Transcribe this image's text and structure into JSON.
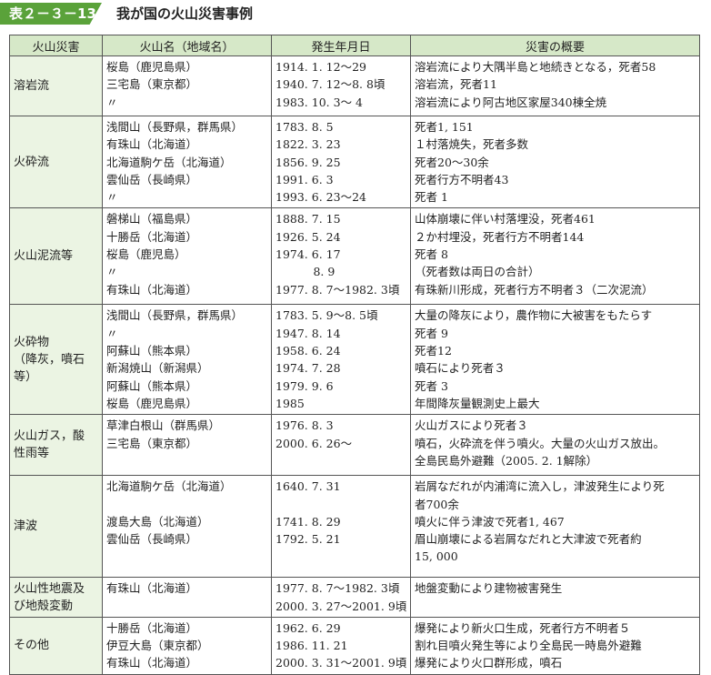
{
  "title": {
    "tab": "表２－３－13",
    "text": "我が国の火山災害事例"
  },
  "headers": [
    "火山災害",
    "火山名（地域名）",
    "発生年月日",
    "災害の概要"
  ],
  "rows": [
    {
      "category": "溶岩流",
      "names": [
        "桜島（鹿児島県）",
        "三宅島（東京都）",
        "〃"
      ],
      "dates": [
        "1914. 1. 12～29",
        "1940. 7. 12～8. 8頃",
        "1983. 10. 3～ 4"
      ],
      "summary": [
        "溶岩流により大隅半島と地続きとなる，死者58",
        "溶岩流，死者11",
        "溶岩流により阿古地区家屋340棟全焼"
      ]
    },
    {
      "category": "火砕流",
      "names": [
        "浅間山（長野県，群馬県）",
        "有珠山（北海道）",
        "北海道駒ケ岳（北海道）",
        "雲仙岳（長崎県）",
        "〃"
      ],
      "dates": [
        "1783. 8. 5",
        "1822. 3. 23",
        "1856. 9. 25",
        "1991. 6. 3",
        "1993. 6. 23～24"
      ],
      "summary": [
        "死者1, 151",
        "１村落焼失，死者多数",
        "死者20～30余",
        "死者行方不明者43",
        "死者 1"
      ]
    },
    {
      "category": "火山泥流等",
      "names": [
        "磐梯山（福島県）",
        "十勝岳（北海道）",
        "桜島（鹿児島）",
        "〃",
        "有珠山（北海道）"
      ],
      "dates": [
        "1888. 7. 15",
        "1926. 5. 24",
        "1974. 6. 17",
        "　　　 8. 9",
        "1977. 8. 7～1982. 3頃"
      ],
      "summary": [
        "山体崩壊に伴い村落埋没，死者461",
        "２か村埋没，死者行方不明者144",
        "死者 8",
        "（死者数は両日の合計）",
        "有珠新川形成，死者行方不明者３（二次泥流）"
      ]
    },
    {
      "category": "火砕物\n（降灰，噴石\n等）",
      "names": [
        "浅間山（長野県，群馬県）",
        "〃",
        "阿蘇山（熊本県）",
        "新潟焼山（新潟県）",
        "阿蘇山（熊本県）",
        "桜島（鹿児島県）"
      ],
      "dates": [
        "1783. 5. 9～8. 5頃",
        "1947. 8. 14",
        "1958. 6. 24",
        "1974. 7. 28",
        "1979. 9. 6",
        "1985"
      ],
      "summary": [
        "大量の降灰により，農作物に大被害をもたらす",
        "死者 9",
        "死者12",
        "噴石により死者３",
        "死者 3",
        "年間降灰量観測史上最大"
      ]
    },
    {
      "category": "火山ガス，酸\n性雨等",
      "names": [
        "草津白根山（群馬県）",
        "三宅島（東京都）"
      ],
      "dates": [
        "1976. 8. 3",
        "2000. 6. 26～"
      ],
      "summary": [
        "火山ガスにより死者３",
        "噴石，火砕流を伴う噴火。大量の火山ガス放出。",
        "全島民島外避難（2005. 2. 1解除）"
      ]
    },
    {
      "category": "津波",
      "names": [
        "北海道駒ケ岳（北海道）",
        "",
        "渡島大島（北海道）",
        "雲仙岳（長崎県）"
      ],
      "dates": [
        "1640. 7. 31",
        "",
        "1741. 8. 29",
        "1792. 5. 21"
      ],
      "summary": [
        "岩屑なだれが内浦湾に流入し，津波発生により死",
        "者700余",
        "噴火に伴う津波で死者1, 467",
        "眉山崩壊による岩屑なだれと大津波で死者約",
        "15, 000"
      ]
    },
    {
      "category": "火山性地震及\nび地殻変動",
      "names": [
        "有珠山（北海道）"
      ],
      "dates": [
        "1977. 8. 7～1982. 3頃",
        "2000. 3. 27～2001. 9頃"
      ],
      "summary": [
        "地盤変動により建物被害発生"
      ]
    },
    {
      "category": "その他",
      "names": [
        "十勝岳（北海道）",
        "伊豆大島（東京都）",
        "有珠山（北海道）"
      ],
      "dates": [
        "1962. 6. 29",
        "1986. 11. 21",
        "2000. 3. 31～2001. 9頃"
      ],
      "summary": [
        "爆発により新火口生成，死者行方不明者５",
        "割れ目噴火発生等により全島民一時島外避難",
        "爆発により火口群形成，噴石"
      ]
    }
  ]
}
